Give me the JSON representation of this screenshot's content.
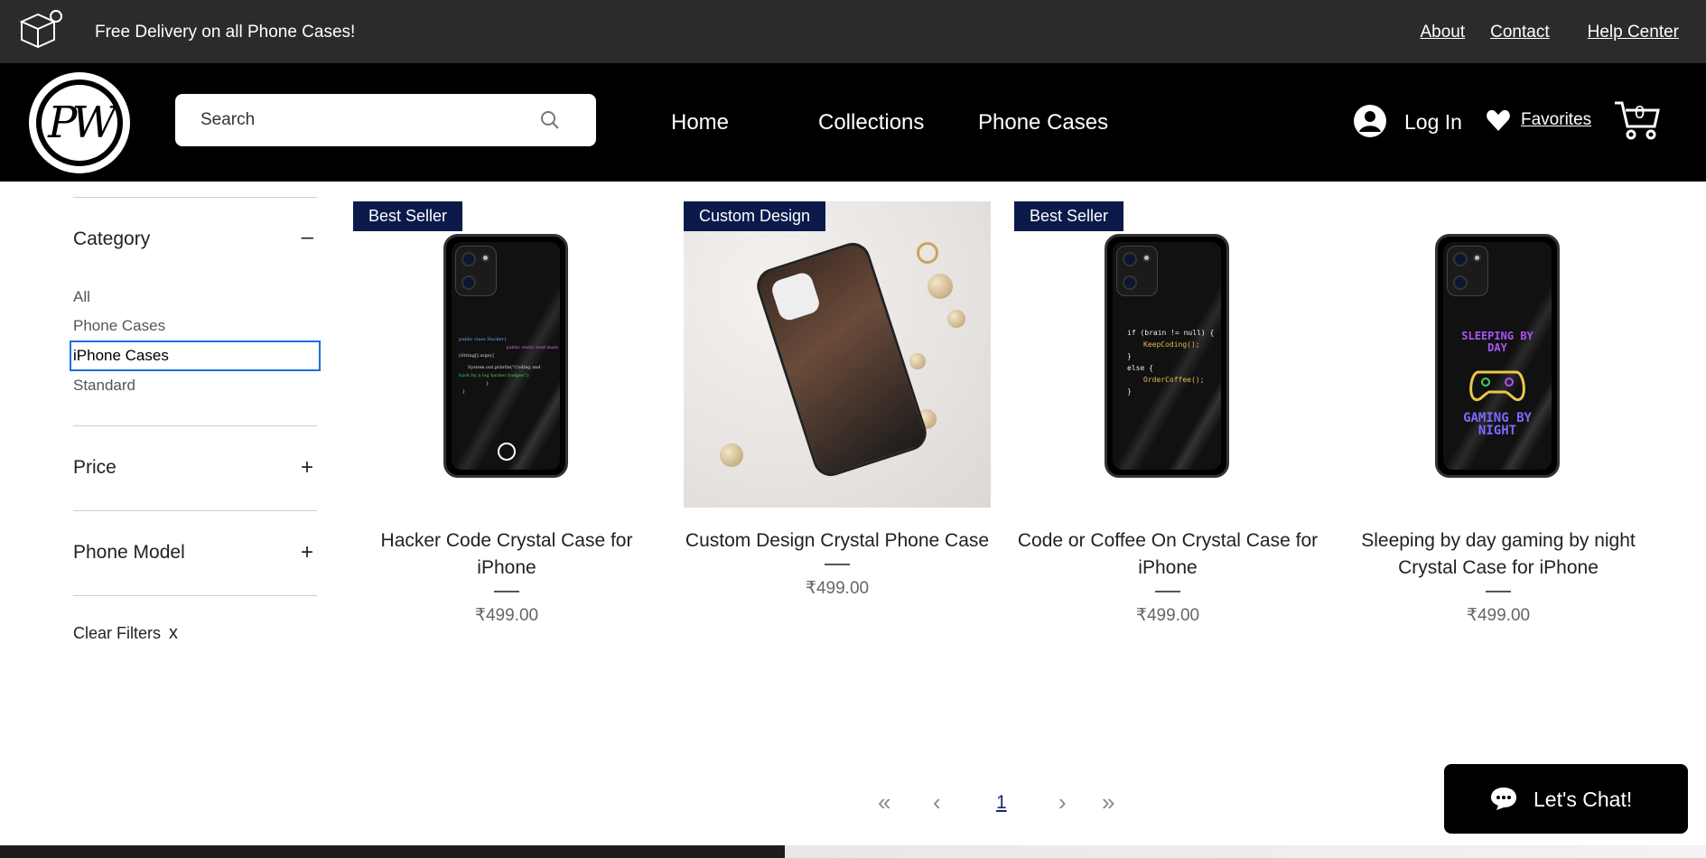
{
  "topbar": {
    "promo": "Free Delivery on all Phone Cases!",
    "links": {
      "about": "About",
      "contact": "Contact",
      "help": "Help Center"
    }
  },
  "header": {
    "logo_text": "PW",
    "search": {
      "placeholder": "Search"
    },
    "nav": {
      "home": "Home",
      "collections": "Collections",
      "phone_cases": "Phone Cases"
    },
    "login": "Log In",
    "favorites": "Favorites",
    "cart_count": "0"
  },
  "filters": {
    "category": {
      "title": "Category",
      "toggle": "–",
      "items": [
        "All",
        "Phone Cases",
        "iPhone Cases",
        "Standard"
      ],
      "selected": "iPhone Cases"
    },
    "price": {
      "title": "Price",
      "toggle": "+"
    },
    "phone_model": {
      "title": "Phone Model",
      "toggle": "+"
    },
    "clear": "Clear Filters",
    "clear_icon": "x"
  },
  "products": [
    {
      "badge": "Best Seller",
      "name": "Hacker Code Crystal Case for iPhone",
      "price": "₹499.00"
    },
    {
      "badge": "Custom Design",
      "name": "Custom Design Crystal Phone Case",
      "price": "₹499.00"
    },
    {
      "badge": "Best Seller",
      "name": "Code or Coffee On Crystal Case for iPhone",
      "price": "₹499.00"
    },
    {
      "badge": "",
      "name": "Sleeping by day gaming by night Crystal Case for iPhone",
      "price": "₹499.00"
    }
  ],
  "case_art": {
    "hacker": [
      "public class Hacker{",
      "public static void main",
      "(String[] args){",
      "System.out.println(\"Coding and",
      "hack by a log hacker badges\");",
      "}",
      "}"
    ],
    "coffee": [
      "if (brain != null) {",
      "KeepCoding();",
      "}",
      "else {",
      "OrderCoffee();",
      "}"
    ],
    "gaming_top": "SLEEPING BY DAY",
    "gaming_bottom": "GAMING BY NIGHT"
  },
  "pagination": {
    "first": "«",
    "prev": "‹",
    "current": "1",
    "next": "›",
    "last": "»"
  },
  "chat": {
    "label": "Let's Chat!"
  },
  "colors": {
    "badge": "#0b1a4a",
    "topbar": "#2b2b2b",
    "header": "#000000",
    "selected_outline": "#1a6fe0"
  }
}
